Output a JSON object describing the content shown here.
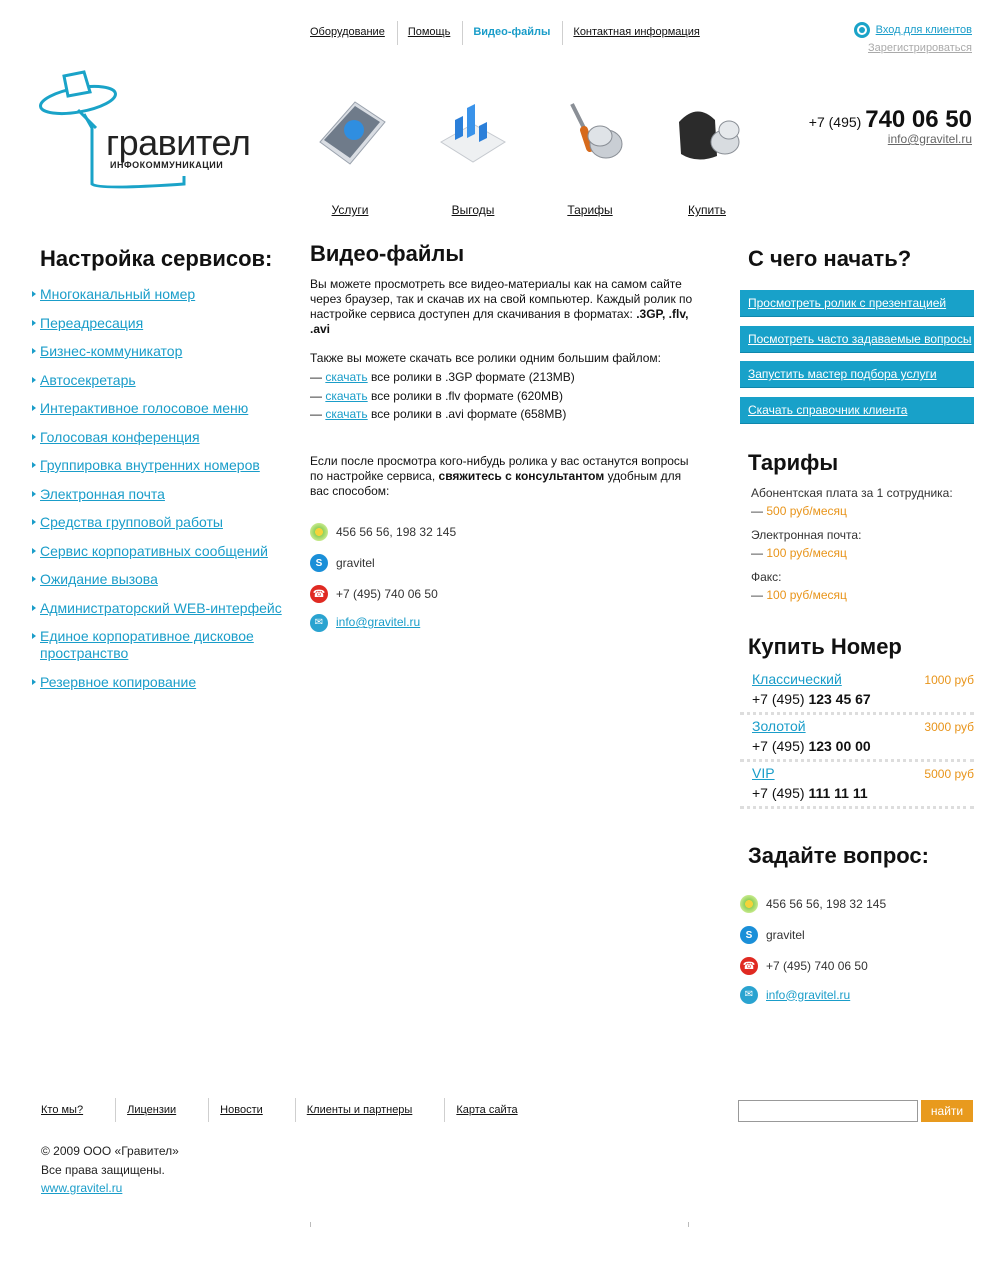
{
  "topnav": {
    "items": [
      "Оборудование",
      "Помощь",
      "Видео-файлы",
      "Контактная информация"
    ],
    "active": "Видео-файлы"
  },
  "login": {
    "label": "Вход для клиентов",
    "register": "Зарегистрироваться"
  },
  "logo": {
    "name": "гравител",
    "sub": "ИНФОКОММУНИКАЦИИ"
  },
  "products": [
    {
      "label": "Услуги",
      "icon": "book-icon"
    },
    {
      "label": "Выгоды",
      "icon": "chart-icon"
    },
    {
      "label": "Тарифы",
      "icon": "screwdriver-coins-icon"
    },
    {
      "label": "Купить",
      "icon": "wallet-icon"
    }
  ],
  "contact_top": {
    "code": "+7 (495)",
    "number": "740 06 50",
    "email": "info@gravitel.ru"
  },
  "left": {
    "title": "Настройка сервисов:",
    "items": [
      "Многоканальный номер",
      "Переадресация",
      "Бизнес-коммуникатор",
      "Автосекретарь",
      "Интерактивное голосовое меню",
      "Голосовая конференция",
      "Группировка внутренних номеров",
      "Электронная почта",
      "Средства групповой работы",
      "Сервис корпоративных сообщений",
      "Ожидание вызова",
      "Администраторский WEB-интерфейс",
      "Единое корпоративное дисковое пространство",
      "Резервное копирование"
    ]
  },
  "main": {
    "title": "Видео-файлы",
    "intro": "Вы можете просмотреть все видео-материалы как на самом сайте через браузер, так и скачав их на свой компьютер. Каждый ролик по настройке сервиса доступен для скачивания в форматах:",
    "formats": ".3GP, .flv, .avi",
    "also": "Также вы можете скачать все ролики одним большим файлом:",
    "downloads": [
      {
        "link": "скачать",
        "text": "все ролики в .3GP формате (213MB)"
      },
      {
        "link": "скачать",
        "text": "все ролики в .flv формате (620MB)"
      },
      {
        "link": "скачать",
        "text": "все ролики в .avi формате (658MB)"
      }
    ],
    "question_a": "Если после просмотра кого-нибудь ролика у вас останутся вопросы по настройке сервиса,",
    "question_b": "свяжитесь с консультантом",
    "question_c": "удобным для вас способом:",
    "contacts": {
      "icq": "456 56 56, 198 32 145",
      "skype": "gravitel",
      "phone": "+7 (495) 740 06 50",
      "email": "info@gravitel.ru"
    }
  },
  "right": {
    "start_title": "С чего начать?",
    "buttons": [
      "Просмотреть ролик с презентацией",
      "Посмотреть часто задаваемые вопросы",
      "Запустить мастер подбора услуги",
      "Скачать справочник клиента"
    ],
    "tariffs_title": "Тарифы",
    "tariffs": [
      {
        "label": "Абонентская плата за 1 сотрудника:",
        "price": "500 руб/месяц"
      },
      {
        "label": "Электронная почта:",
        "price": "100 руб/месяц"
      },
      {
        "label": "Факс:",
        "price": "100 руб/месяц"
      }
    ],
    "buy_title": "Купить Номер",
    "numbers": [
      {
        "name": "Классический",
        "price": "1000 руб",
        "code": "+7 (495)",
        "number": "123 45 67"
      },
      {
        "name": "Золотой",
        "price": "3000 руб",
        "code": "+7 (495)",
        "number": "123 00 00"
      },
      {
        "name": "VIP",
        "price": "5000 руб",
        "code": "+7 (495)",
        "number": "111 11 11"
      }
    ],
    "ask_title": "Задайте вопрос:",
    "contacts": {
      "icq": "456 56 56, 198 32 145",
      "skype": "gravitel",
      "phone": "+7 (495) 740 06 50",
      "email": "info@gravitel.ru"
    }
  },
  "footer": {
    "nav": [
      "Кто мы?",
      "Лицензии",
      "Новости",
      "Клиенты и партнеры",
      "Карта сайта"
    ],
    "search_button": "найти",
    "copyright": "© 2009 ООО «Гравител»",
    "rights": "Все права защищены.",
    "site": "www.gravitel.ru"
  },
  "colors": {
    "accent": "#1a9dc9",
    "price": "#e8941a",
    "button_bg": "#18a1c9"
  }
}
